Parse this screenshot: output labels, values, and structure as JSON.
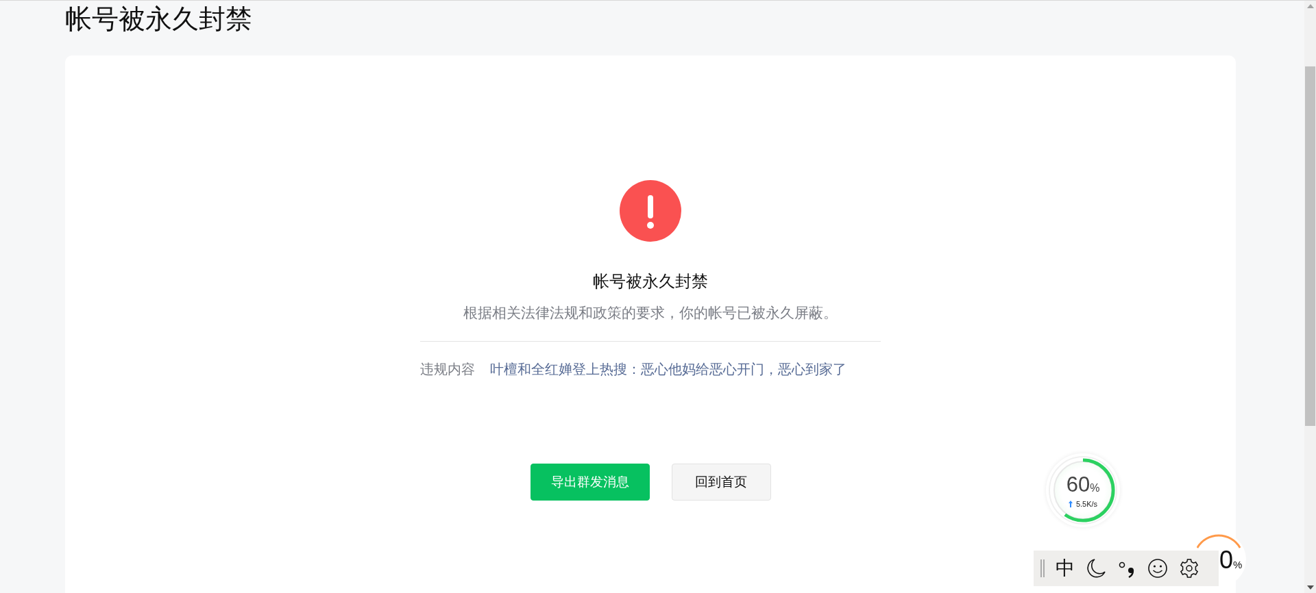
{
  "page_title": "帐号被永久封禁",
  "notice": {
    "kind": "error",
    "heading": "帐号被永久封禁",
    "description": "根据相关法律法规和政策的要求，你的帐号已被永久屏蔽。",
    "violation_label": "违规内容",
    "violation_text": "叶檀和全红婵登上热搜：恶心他妈给恶心开门，恶心到家了"
  },
  "buttons": [
    {
      "label": "导出群发消息",
      "kind": "primary"
    },
    {
      "label": "回到首页",
      "kind": "default"
    }
  ],
  "speed_widget": {
    "percent": "60",
    "unit": "%",
    "speed": "5.5K/s",
    "level": 0.6
  },
  "speed_widget_2": {
    "percent": "0",
    "unit": "%"
  },
  "ime_toolbar": {
    "mode": "中"
  }
}
